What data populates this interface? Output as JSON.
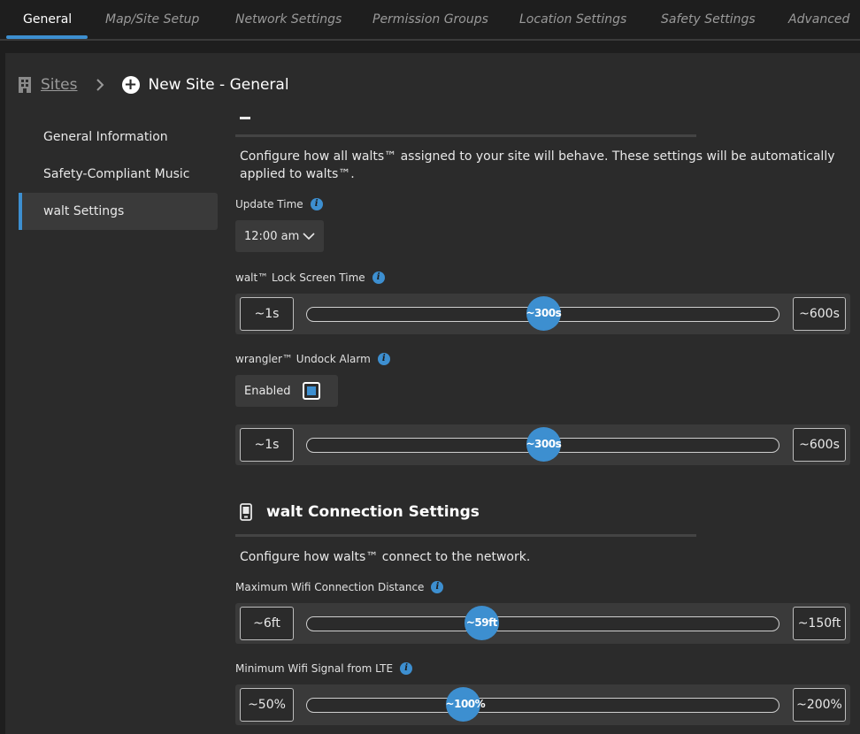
{
  "tabs": [
    {
      "label": "General",
      "active": true
    },
    {
      "label": "Map/Site Setup",
      "active": false
    },
    {
      "label": "Network Settings",
      "active": false
    },
    {
      "label": "Permission Groups",
      "active": false
    },
    {
      "label": "Location Settings",
      "active": false
    },
    {
      "label": "Safety Settings",
      "active": false
    },
    {
      "label": "Advanced",
      "active": false
    }
  ],
  "breadcrumb": {
    "root_icon": "building-icon",
    "root_label": "Sites",
    "separator_icon": "chevron-right-icon",
    "current_icon": "plus-circle-icon",
    "current_label": "New Site - General"
  },
  "sidebar": {
    "items": [
      {
        "label": "General Information",
        "active": false
      },
      {
        "label": "Safety-Compliant Music",
        "active": false
      },
      {
        "label": "walt Settings",
        "active": true
      }
    ]
  },
  "walt_settings": {
    "description": "Configure how all walts™ assigned to your site will behave. These settings will be automatically applied to walts™.",
    "update_time": {
      "label": "Update Time",
      "value": "12:00 am"
    },
    "lock_screen": {
      "label": "walt™ Lock Screen Time",
      "min": "~1s",
      "max": "~600s",
      "value": "~300s",
      "fraction": 0.5
    },
    "undock_alarm": {
      "label": "wrangler™ Undock Alarm",
      "toggle_label": "Enabled",
      "checked": true,
      "min": "~1s",
      "max": "~600s",
      "value": "~300s",
      "fraction": 0.5
    }
  },
  "connection_settings": {
    "title": "walt Connection Settings",
    "title_icon": "walt-device-icon",
    "description": "Configure how walts™ connect to the network.",
    "wifi_distance": {
      "label": "Maximum Wifi Connection Distance",
      "min": "~6ft",
      "max": "~150ft",
      "value": "~59ft",
      "fraction": 0.37
    },
    "wifi_signal": {
      "label": "Minimum Wifi Signal from LTE",
      "min": "~50%",
      "max": "~200%",
      "value": "~100%",
      "fraction": 0.33
    }
  },
  "colors": {
    "accent": "#3d8fd0",
    "background": "#1e1e1e",
    "panel": "#2b2b2b",
    "control": "#3a3a3a"
  }
}
